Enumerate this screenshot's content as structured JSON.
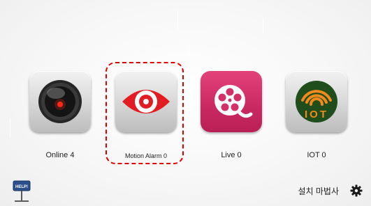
{
  "tiles": [
    {
      "label": "Online 4",
      "icon": "camera-lens-icon"
    },
    {
      "label": "Motion Alarm 0",
      "icon": "eye-icon"
    },
    {
      "label": "Live 0",
      "icon": "film-reel-icon"
    },
    {
      "label": "IOT 0",
      "icon": "iot-wifi-icon"
    }
  ],
  "iot_icon_text": "IOT",
  "help_label": "HELP!",
  "setup_wizard_label": "설치 마법사",
  "colors": {
    "selection_border": "#e00000",
    "eye_red": "#e31b23",
    "live_pink": "#d33068",
    "iot_orange": "#f08a1c",
    "iot_green": "#1f4d1c"
  }
}
